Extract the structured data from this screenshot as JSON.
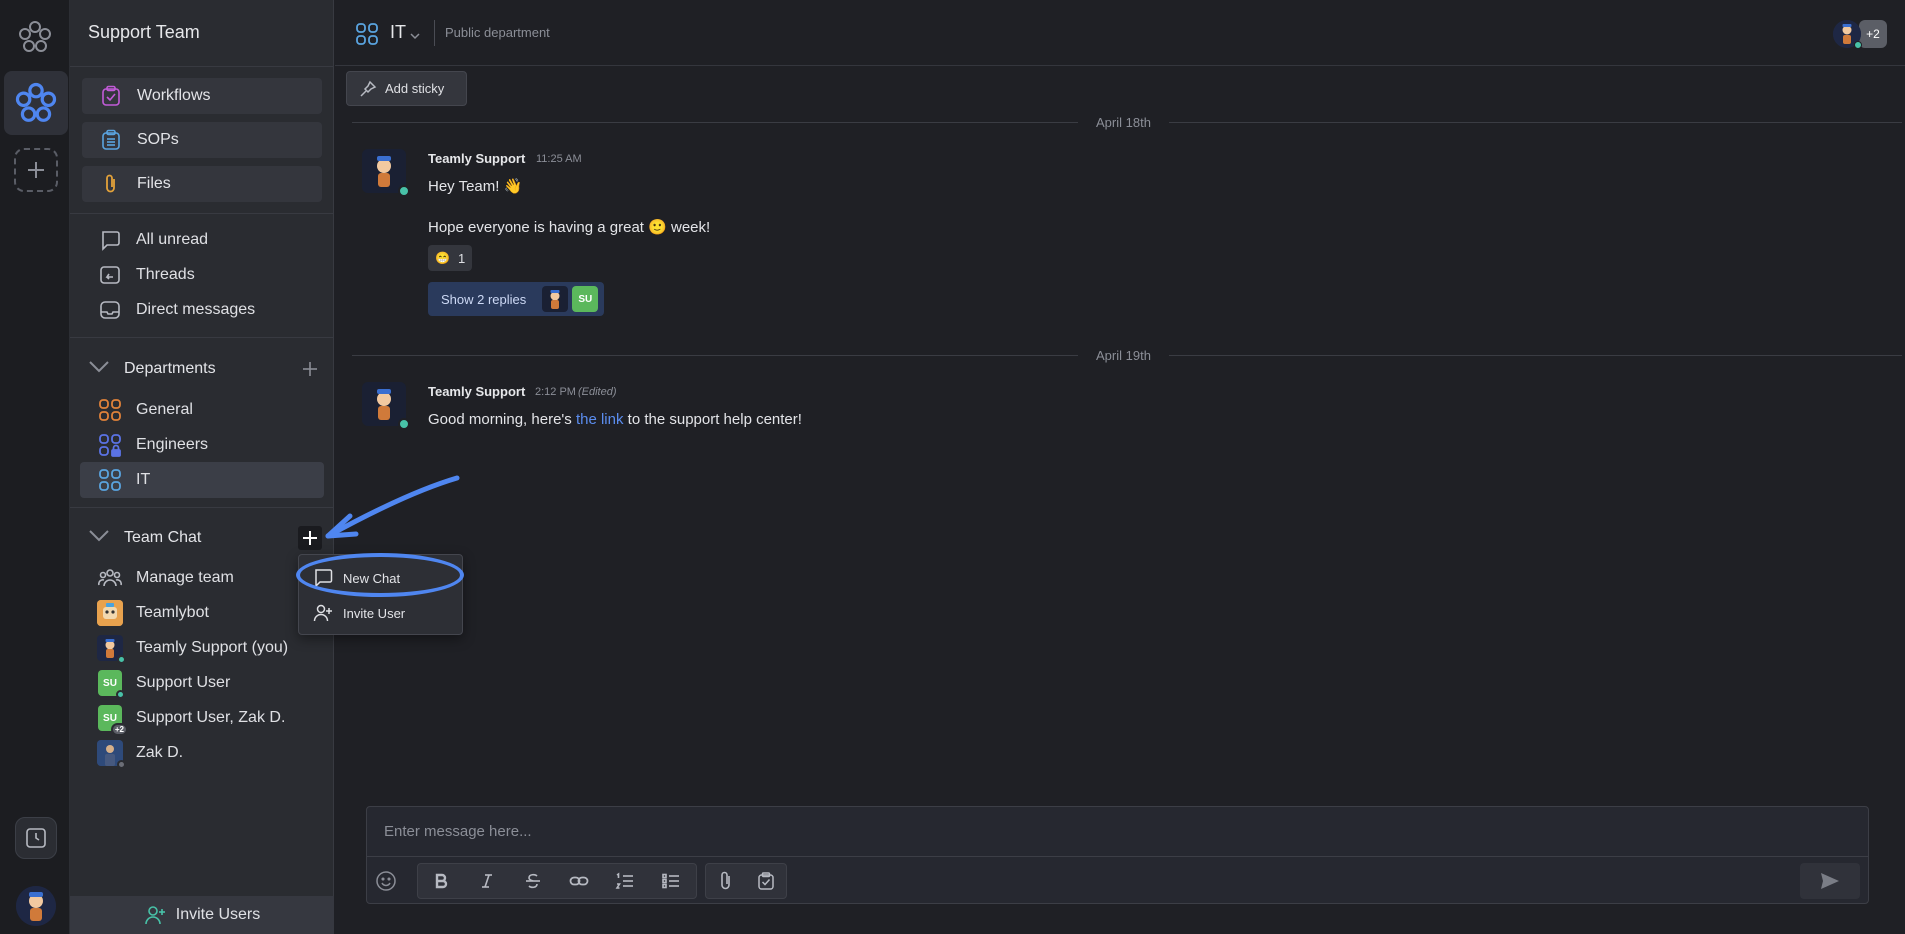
{
  "sidebar": {
    "title": "Support Team",
    "features": [
      {
        "label": "Workflows",
        "icon": "workflow-icon",
        "color": "#c25bd8"
      },
      {
        "label": "SOPs",
        "icon": "sop-icon",
        "color": "#5aa4e0"
      },
      {
        "label": "Files",
        "icon": "paperclip-icon",
        "color": "#e3a23a"
      }
    ],
    "nav": [
      {
        "label": "All unread",
        "icon": "chat-bubble-icon"
      },
      {
        "label": "Threads",
        "icon": "threads-icon"
      },
      {
        "label": "Direct messages",
        "icon": "inbox-icon"
      }
    ],
    "departments": {
      "label": "Departments",
      "items": [
        {
          "label": "General",
          "icon": "department-icon",
          "color": "#e0823a"
        },
        {
          "label": "Engineers",
          "icon": "private-department-icon",
          "color": "#5b73e6"
        },
        {
          "label": "IT",
          "icon": "department-icon",
          "color": "#5aa4e0"
        }
      ]
    },
    "team_chat": {
      "label": "Team Chat",
      "items": [
        {
          "label": "Manage team",
          "icon": "team-icon"
        },
        {
          "label": "Teamlybot",
          "avatar": "bot-avatar"
        },
        {
          "label": "Teamly Support (you)",
          "avatar": "support-avatar",
          "status_color": "#48c2a8"
        },
        {
          "label": "Support User",
          "avatar_text": "SU",
          "avatar_color": "#5bb85c",
          "status_color": "#48c2a8"
        },
        {
          "label": "Support User, Zak D.",
          "avatar_text": "SU",
          "avatar_color": "#5bb85c",
          "badge": "+2"
        },
        {
          "label": "Zak D.",
          "avatar": "zak-avatar",
          "status_color": "#6b6e77"
        }
      ]
    },
    "invite_label": "Invite Users"
  },
  "channel": {
    "name": "IT",
    "description": "Public department",
    "extra_members": "+2"
  },
  "toolbar": {
    "sticky_label": "Add sticky"
  },
  "messages": {
    "day1": "April 18th",
    "day2": "April 19th",
    "m1": {
      "author": "Teamly Support",
      "time": "11:25 AM",
      "line1": "Hey Team! 👋",
      "line2": "Hope everyone is having a great 🙂 week!",
      "reaction_emoji": "😁",
      "reaction_count": "1",
      "replies_label": "Show 2 replies",
      "reply_avatar_text": "SU"
    },
    "m2": {
      "author": "Teamly Support",
      "time": "2:12 PM",
      "edited": "(Edited)",
      "text_before": "Good morning, here's ",
      "link": "the link",
      "text_after": " to the support help center!"
    }
  },
  "menu": {
    "new_chat": "New Chat",
    "invite_user": "Invite User"
  },
  "composer": {
    "placeholder": "Enter message here..."
  },
  "colors": {
    "accent": "#4f86f0",
    "online": "#48c2a8"
  }
}
